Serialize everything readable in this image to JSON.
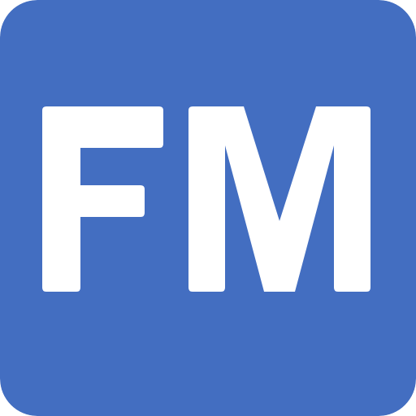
{
  "icon": {
    "name": "fm-app-icon",
    "text": "FM",
    "background_color": "#436ec1",
    "text_color": "#ffffff"
  }
}
